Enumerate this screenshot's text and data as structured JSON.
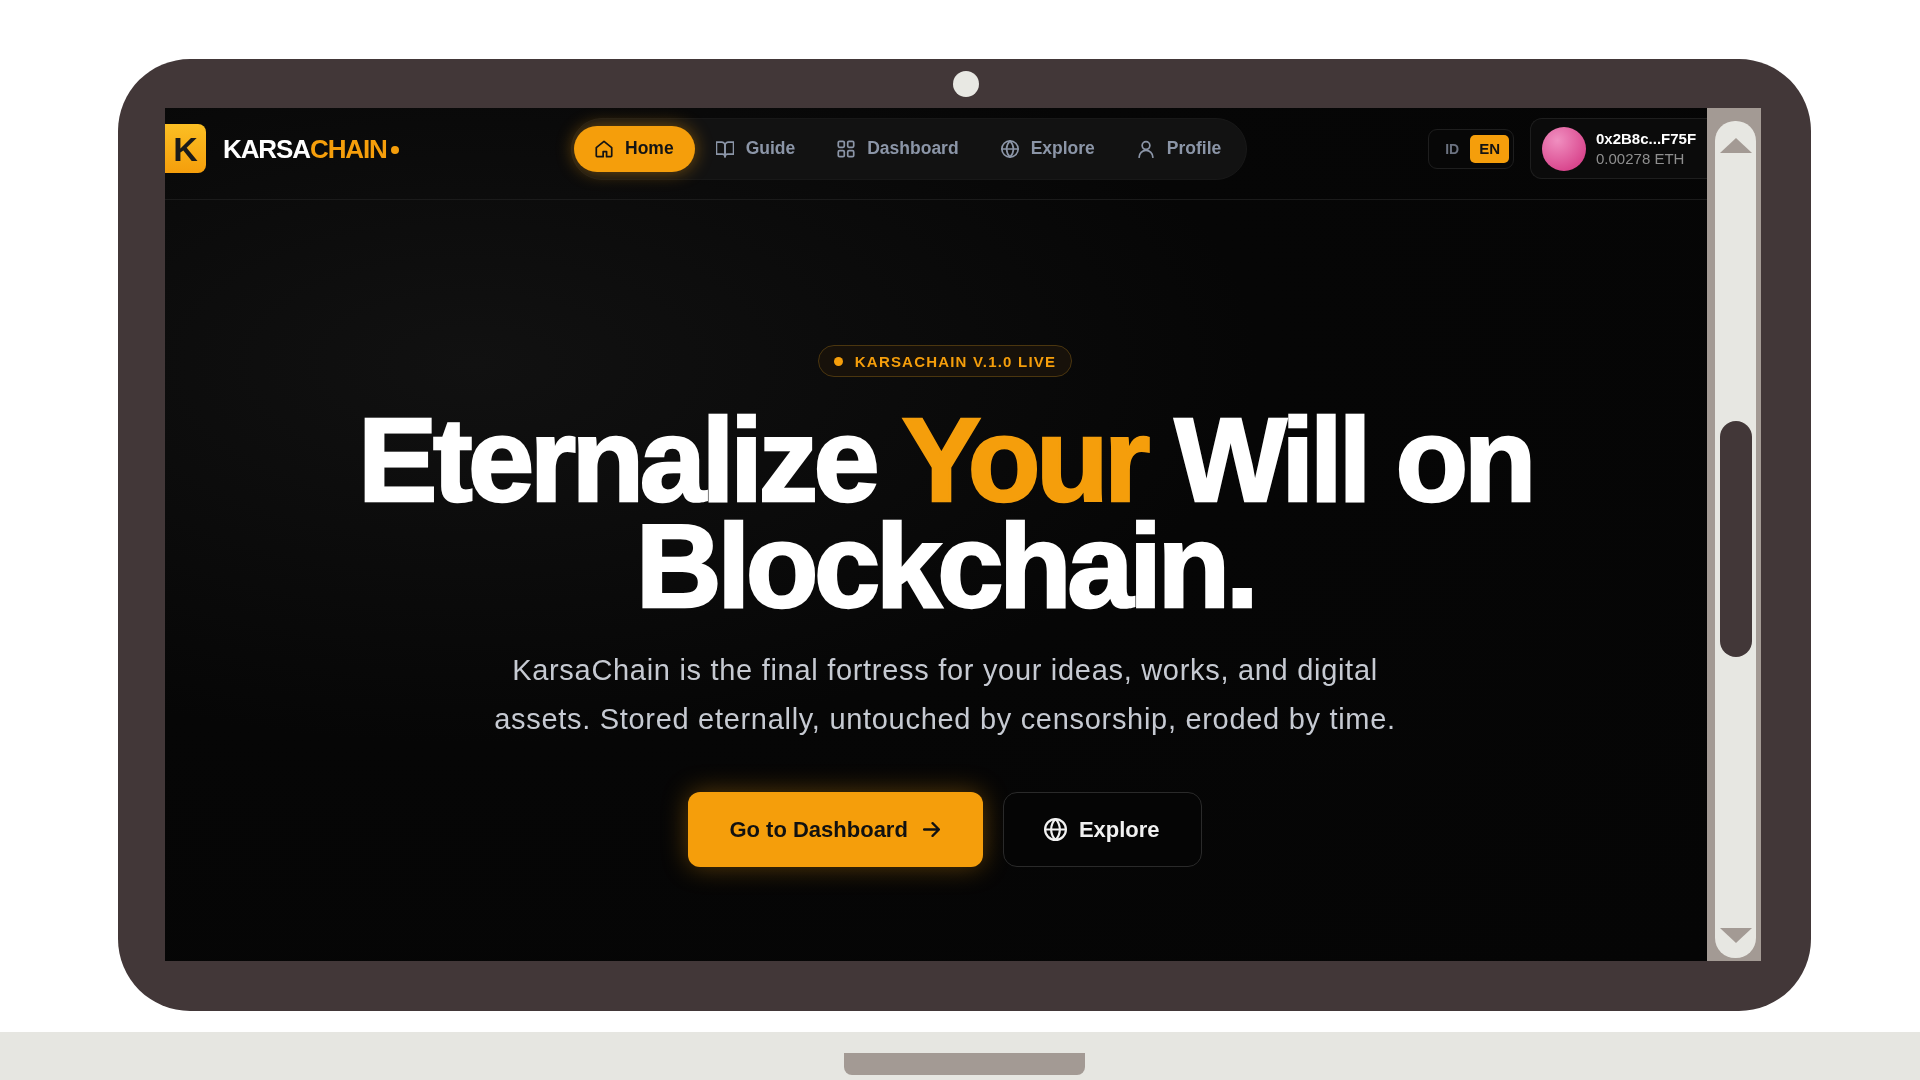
{
  "navbar": {
    "logo": {
      "letter": "K",
      "wordmark": [
        {
          "text": "KARSA",
          "accent": false
        },
        {
          "text": "CHAIN",
          "accent": true
        }
      ]
    },
    "nav_items": [
      {
        "label": "Home",
        "selected": true
      },
      {
        "label": "Guide",
        "selected": false
      },
      {
        "label": "Dashboard",
        "selected": false
      },
      {
        "label": "Explore",
        "selected": false
      },
      {
        "label": "Profile",
        "selected": false
      }
    ],
    "languages": [
      {
        "label": "ID",
        "selected": false
      },
      {
        "label": "EN",
        "selected": true
      }
    ],
    "wallet": {
      "address": "0x2B8c...F75F",
      "balance": "0.00278 ETH"
    }
  },
  "hero": {
    "badge": "KARSACHAIN V.1.0 LIVE",
    "headline": [
      {
        "text": "Eternalize",
        "accent": false
      },
      {
        "text": "Your",
        "accent": true
      },
      {
        "text": "Will on Blockchain.",
        "accent": false
      }
    ],
    "description": "KarsaChain is the final fortress for your ideas, works, and digital assets. Stored eternally, untouched by censorship, eroded by time.",
    "buttons": [
      {
        "label": "Go to Dashboard",
        "kind": "primary"
      },
      {
        "label": "Explore",
        "kind": "secondary"
      }
    ]
  }
}
